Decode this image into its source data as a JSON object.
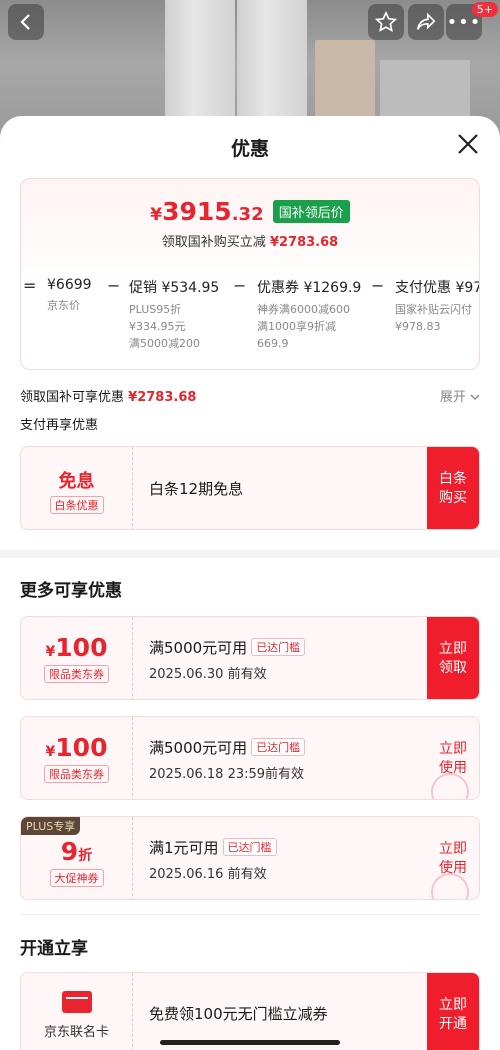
{
  "header": {
    "back_icon": "chevron-left-icon",
    "icons": [
      "star-icon",
      "share-icon",
      "more-icon"
    ],
    "more_badge": "5+"
  },
  "sheet": {
    "title": "优惠"
  },
  "price_box": {
    "currency": "¥",
    "price_int": "3915",
    "price_dec": ".32",
    "tag": "国补领后价",
    "subtitle_prefix": "领取国补购买立减",
    "subtitle_amount": "¥2783.68",
    "calc": [
      {
        "op": "=",
        "main": "¥6699",
        "lines": [
          "京东价"
        ]
      },
      {
        "op": "−",
        "main": "促销 ¥534.95",
        "lines": [
          "PLUS95折",
          "¥334.95元",
          "满5000减200"
        ]
      },
      {
        "op": "−",
        "main": "优惠券 ¥1269.9",
        "lines": [
          "神券满6000减600",
          "满1000享9折减",
          "669.9"
        ]
      },
      {
        "op": "−",
        "main": "支付优惠 ¥97",
        "lines": [
          "国家补贴云闪付",
          "¥978.83"
        ]
      }
    ]
  },
  "national_line": {
    "prefix": "领取国补可享优惠",
    "amount": "¥2783.68",
    "expand": "展开"
  },
  "pay_line": "支付再享优惠",
  "baitiao": {
    "title": "免息",
    "tag": "白条优惠",
    "text": "白条12期免息",
    "button": "白条\n购买"
  },
  "more_section": {
    "title": "更多可享优惠",
    "coupons": [
      {
        "symbol": "¥",
        "amount": "100",
        "type": "限品类东券",
        "cond": "满5000元可用",
        "badge": "已达门槛",
        "date": "2025.06.30 前有效",
        "button": "立即\n领取",
        "style": "red"
      },
      {
        "symbol": "¥",
        "amount": "100",
        "type": "限品类东券",
        "cond": "满5000元可用",
        "badge": "已达门槛",
        "date": "2025.06.18 23:59前有效",
        "button": "立即\n使用",
        "style": "pale"
      },
      {
        "plus": "PLUS专享",
        "amount": "9",
        "unit": "折",
        "type": "大促神券",
        "cond": "满1元可用",
        "badge": "已达门槛",
        "date": "2025.06.16 前有效",
        "button": "立即\n使用",
        "style": "pale"
      }
    ]
  },
  "open_section": {
    "title": "开通立享",
    "card_text": "免费领100元无门槛立减券",
    "card_label": "京东联名卡",
    "button": "立即\n开通"
  }
}
